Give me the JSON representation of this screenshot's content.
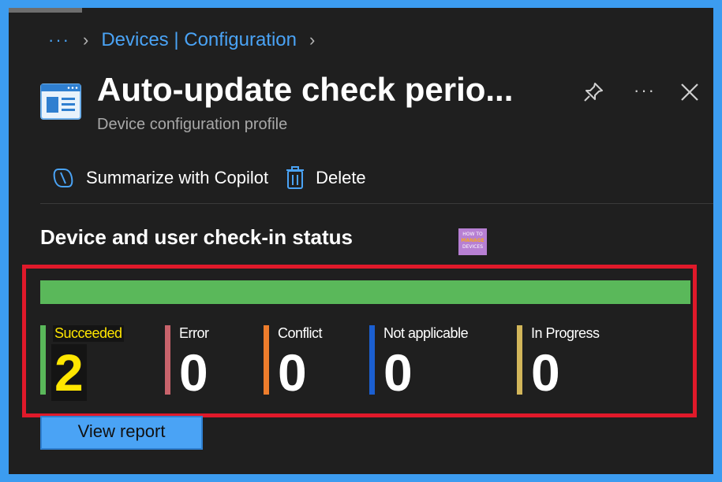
{
  "breadcrumb": {
    "ellipsis": "···",
    "link": "Devices | Configuration"
  },
  "header": {
    "title": "Auto-update check perio...",
    "subtitle": "Device configuration profile",
    "more": "···"
  },
  "toolbar": {
    "copilot_label": "Summarize with Copilot",
    "delete_label": "Delete"
  },
  "section": {
    "title": "Device and user check-in status",
    "badge_lines": [
      "HOW TO",
      "MANAGE",
      "DEVICES"
    ]
  },
  "status": {
    "bar_color": "#5ab85a",
    "items": [
      {
        "label": "Succeeded",
        "value": "2",
        "color": "#5ab85a"
      },
      {
        "label": "Error",
        "value": "0",
        "color": "#c8636b"
      },
      {
        "label": "Conflict",
        "value": "0",
        "color": "#ee7d2c"
      },
      {
        "label": "Not applicable",
        "value": "0",
        "color": "#1b5fd1"
      },
      {
        "label": "In Progress",
        "value": "0",
        "color": "#d2b65a"
      }
    ]
  },
  "actions": {
    "view_report_label": "View report"
  },
  "colors": {
    "accent": "#4aa3f5",
    "highlight": "#e0192a",
    "frame": "#3c9cf0"
  }
}
